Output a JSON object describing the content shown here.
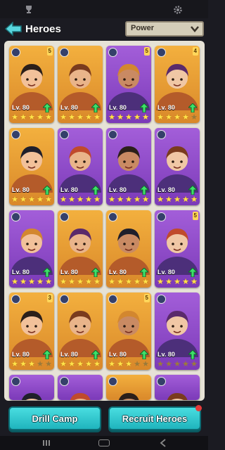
{
  "header": {
    "title": "Heroes",
    "sort": {
      "selected": "Power"
    }
  },
  "heroes": [
    {
      "level": "Lv. 80",
      "color": "orange",
      "stage": "5",
      "stars_on": 5
    },
    {
      "level": "Lv. 80",
      "color": "orange",
      "stage": "",
      "stars_on": 5
    },
    {
      "level": "Lv. 80",
      "color": "purple",
      "stage": "5",
      "stars_on": 5
    },
    {
      "level": "Lv. 80",
      "color": "orange",
      "stage": "4",
      "stars_on": 4
    },
    {
      "level": "Lv. 80",
      "color": "orange",
      "stage": "",
      "stars_on": 5
    },
    {
      "level": "Lv. 80",
      "color": "purple",
      "stage": "",
      "stars_on": 5
    },
    {
      "level": "Lv. 80",
      "color": "purple",
      "stage": "",
      "stars_on": 5
    },
    {
      "level": "Lv. 80",
      "color": "purple",
      "stage": "",
      "stars_on": 5
    },
    {
      "level": "Lv. 80",
      "color": "purple",
      "stage": "",
      "stars_on": 5
    },
    {
      "level": "Lv. 80",
      "color": "orange",
      "stage": "",
      "stars_on": 5
    },
    {
      "level": "Lv. 80",
      "color": "orange",
      "stage": "",
      "stars_on": 5
    },
    {
      "level": "Lv. 80",
      "color": "purple",
      "stage": "5",
      "stars_on": 5
    },
    {
      "level": "Lv. 80",
      "color": "orange",
      "stage": "3",
      "stars_on": 3
    },
    {
      "level": "Lv. 80",
      "color": "orange",
      "stage": "",
      "stars_on": 5
    },
    {
      "level": "Lv. 80",
      "color": "orange",
      "stage": "5",
      "stars_on": 3
    },
    {
      "level": "Lv. 80",
      "color": "purple",
      "stage": "",
      "stars_on": 0
    }
  ],
  "partial_row": [
    "purple",
    "purple",
    "orange",
    "purple"
  ],
  "buttons": {
    "drill_camp": "Drill Camp",
    "recruit_heroes": "Recruit Heroes"
  },
  "colors": {
    "orange_card": "#f3b03e",
    "purple_card": "#a35ed9",
    "button_teal": "#2fc7cf",
    "panel": "#e6e2d6"
  }
}
